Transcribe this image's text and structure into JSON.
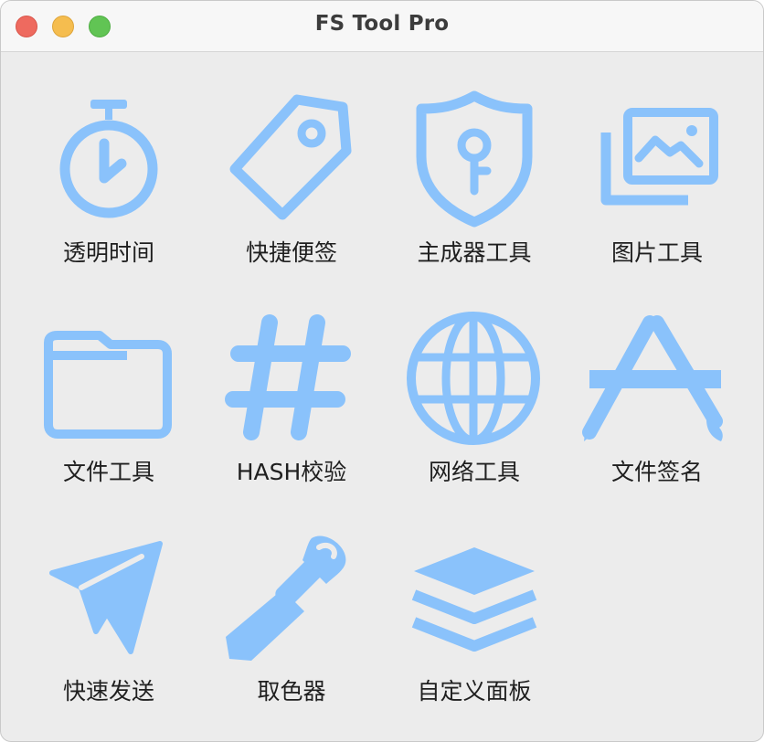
{
  "window": {
    "title": "FS Tool Pro",
    "accent_color": "#8ac2fb"
  },
  "tools": [
    {
      "label": "透明时间",
      "icon": "stopwatch-icon"
    },
    {
      "label": "快捷便签",
      "icon": "tag-icon"
    },
    {
      "label": "主成器工具",
      "icon": "shield-key-icon"
    },
    {
      "label": "图片工具",
      "icon": "photos-icon"
    },
    {
      "label": "文件工具",
      "icon": "folder-icon"
    },
    {
      "label": "HASH校验",
      "icon": "hash-icon"
    },
    {
      "label": "网络工具",
      "icon": "globe-icon"
    },
    {
      "label": "文件签名",
      "icon": "app-store-icon"
    },
    {
      "label": "快速发送",
      "icon": "paper-plane-icon"
    },
    {
      "label": "取色器",
      "icon": "eyedropper-icon"
    },
    {
      "label": "自定义面板",
      "icon": "layers-icon"
    }
  ]
}
